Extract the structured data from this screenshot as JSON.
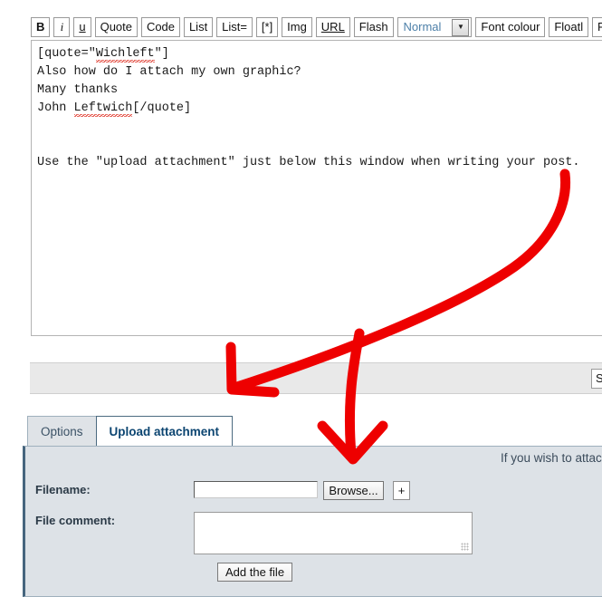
{
  "toolbar": {
    "buttons": [
      {
        "label": "B",
        "name": "bold-button",
        "style": "bold"
      },
      {
        "label": "i",
        "name": "italic-button",
        "style": "ital"
      },
      {
        "label": "u",
        "name": "underline-button",
        "style": "under"
      },
      {
        "label": "Quote",
        "name": "quote-button",
        "style": ""
      },
      {
        "label": "Code",
        "name": "code-button",
        "style": ""
      },
      {
        "label": "List",
        "name": "list-button",
        "style": ""
      },
      {
        "label": "List=",
        "name": "ordered-list-button",
        "style": ""
      },
      {
        "label": "[*]",
        "name": "list-item-button",
        "style": ""
      },
      {
        "label": "Img",
        "name": "image-button",
        "style": ""
      },
      {
        "label": "URL",
        "name": "url-button",
        "style": "url"
      },
      {
        "label": "Flash",
        "name": "flash-button",
        "style": ""
      }
    ],
    "font_size_select": {
      "value": "Normal",
      "arrow": "▼"
    },
    "buttons_right": [
      {
        "label": "Font colour",
        "name": "font-colour-button",
        "style": ""
      },
      {
        "label": "Floatl",
        "name": "float-left-button",
        "style": ""
      },
      {
        "label": "F",
        "name": "float-right-button",
        "style": ""
      }
    ]
  },
  "message": {
    "line1_pre": "[quote=\"",
    "line1_sp": "Wichleft",
    "line1_post": "\"]",
    "line2": "Also how do I attach my own graphic?",
    "line3": "Many thanks",
    "line4_pre": "John ",
    "line4_sp": "Leftwich",
    "line4_post": "[/quote]",
    "line5": "Use the \"upload attachment\" just below this window when writing your post."
  },
  "submit_bar": {
    "submit_label": "S"
  },
  "tabs": [
    {
      "label": "Options",
      "name": "tab-options",
      "active": false
    },
    {
      "label": "Upload attachment",
      "name": "tab-upload-attachment",
      "active": true
    }
  ],
  "attachment_panel": {
    "note": "If you wish to attac",
    "filename_label": "Filename:",
    "filename_value": "",
    "browse_label": "Browse...",
    "plus_label": "+",
    "comment_label": "File comment:",
    "comment_value": "",
    "add_file_label": "Add the file"
  },
  "annotation": {
    "colour": "#ee0000",
    "description": "hand-drawn red arrows pointing to the submit bar and the Upload attachment tab"
  }
}
